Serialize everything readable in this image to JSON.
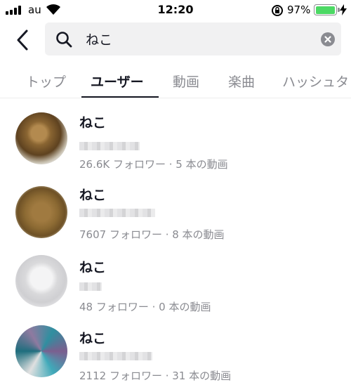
{
  "status_bar": {
    "carrier": "au",
    "time": "12:20",
    "battery_percent": "97%",
    "battery_level": 0.97,
    "battery_color": "#4cd964"
  },
  "search": {
    "query": "ねこ",
    "back_icon": "chevron-left-icon",
    "search_icon": "magnifier-icon",
    "clear_icon": "clear-circle-icon"
  },
  "tabs": {
    "items": [
      {
        "label": "トップ",
        "active": false
      },
      {
        "label": "ユーザー",
        "active": true
      },
      {
        "label": "動画",
        "active": false
      },
      {
        "label": "楽曲",
        "active": false
      },
      {
        "label": "ハッシュタ",
        "active": false
      }
    ]
  },
  "users": [
    {
      "name": "ねこ",
      "meta": "26.6K フォロワー · 5 本の動画",
      "avatar_color": "#7a5a2c"
    },
    {
      "name": "ねこ",
      "meta": "7607 フォロワー · 8 本の動画",
      "avatar_color": "#8c6a33"
    },
    {
      "name": "ねこ",
      "meta": "48 フォロワー · 0 本の動画",
      "avatar_color": "#dcdcde"
    },
    {
      "name": "ねこ",
      "meta": "2112 フォロワー · 31 本の動画",
      "avatar_color": "#2f8fa0"
    }
  ],
  "colors": {
    "text_primary": "#161823",
    "text_secondary": "#8a8b91",
    "search_bg": "#f1f1f2"
  }
}
